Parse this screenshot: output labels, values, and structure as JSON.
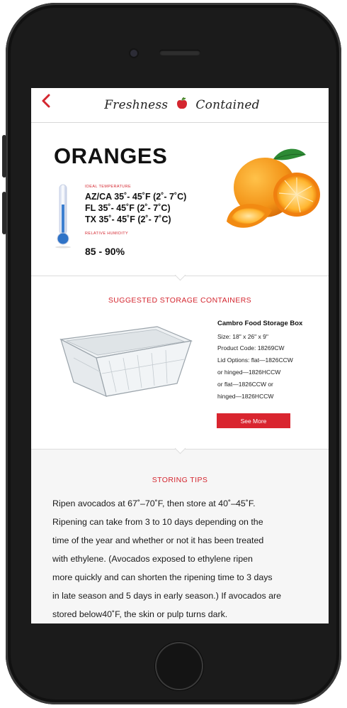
{
  "header": {
    "back_icon": "chevron-left-icon",
    "title_left": "Freshness",
    "title_right": "Contained",
    "logo_icon": "apple-icon",
    "accent_color": "#d4262f"
  },
  "product": {
    "name": "ORANGES",
    "ideal_temp_label": "IDEAL TEMPERATURE",
    "temps": [
      "AZ/CA 35˚- 45˚F  (2˚- 7˚C)",
      "FL 35˚- 45˚F  (2˚- 7˚C)",
      "TX 35˚- 45˚F  (2˚- 7˚C)"
    ],
    "humidity_label": "RELATIVE HUMIDITY",
    "humidity_value": "85 - 90%",
    "thermometer_icon": "thermometer-icon",
    "image": "oranges-image"
  },
  "containers": {
    "heading": "SUGGESTED STORAGE CONTAINERS",
    "name": "Cambro Food Storage Box",
    "specs": [
      "Size: 18\" x 26\" x 9\"",
      "Product Code: 18269CW",
      "Lid Options: flat—1826CCW",
      "or hinged—1826HCCW",
      "or flat—1826CCW or",
      "hinged—1826HCCW"
    ],
    "see_more_label": "See More",
    "image": "storage-box-image"
  },
  "tips": {
    "heading": "STORING TIPS",
    "lines": [
      "Ripen avocados at 67˚–70˚F, then store at 40˚–45˚F.",
      "Ripening can take from 3 to 10 days depending on the",
      "time of the year and whether or not it has been treated",
      "with ethylene. (Avocados exposed to ethylene ripen",
      "more quickly and can shorten the ripening time to 3 days",
      "in late season and 5 days in early season.) If avocados are",
      "stored below40˚F, the skin or pulp turns dark."
    ]
  }
}
